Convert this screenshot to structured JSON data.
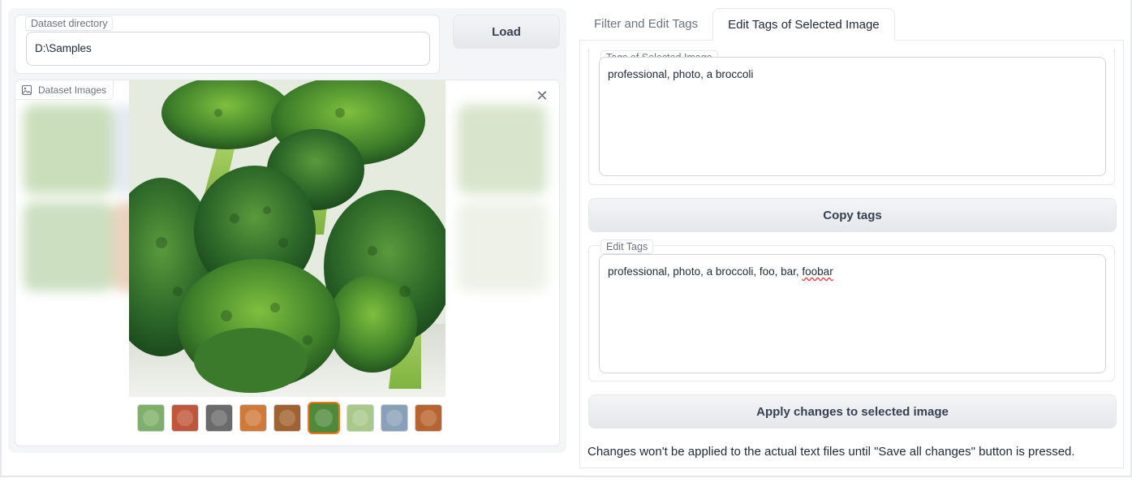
{
  "left": {
    "dataset_directory": {
      "label": "Dataset directory",
      "value": "D:\\Samples"
    },
    "load_button": "Load",
    "gallery": {
      "label": "Dataset Images",
      "selected_index": 5,
      "thumbnails": [
        {
          "name": "broccoli-tree",
          "bg": "#7fb069"
        },
        {
          "name": "pizza",
          "bg": "#c0563a"
        },
        {
          "name": "einstein-bw",
          "bg": "#6b6b6b"
        },
        {
          "name": "pizza",
          "bg": "#d07a3a"
        },
        {
          "name": "einstein-color",
          "bg": "#a0622e"
        },
        {
          "name": "broccoli",
          "bg": "#4f8a3a"
        },
        {
          "name": "broccoli",
          "bg": "#a9c98a"
        },
        {
          "name": "einstein-color",
          "bg": "#8aa0b8"
        },
        {
          "name": "pizza",
          "bg": "#b8642e"
        }
      ]
    }
  },
  "right": {
    "tabs": [
      {
        "label": "Filter and Edit Tags",
        "active": false
      },
      {
        "label": "Edit Tags of Selected Image",
        "active": true
      }
    ],
    "tags_of_selected_image": {
      "label": "Tags of Selected Image",
      "value": "professional, photo, a broccoli"
    },
    "copy_tags_button": "Copy tags",
    "edit_tags": {
      "label": "Edit Tags",
      "value_prefix": "professional, photo, a broccoli, foo, bar, ",
      "value_misspelled": "foobar"
    },
    "apply_button": "Apply changes to selected image",
    "note": "Changes won't be applied to the actual text files until \"Save all changes\" button is pressed."
  },
  "colors": {
    "accent_selected": "#f97316",
    "spellcheck": "#ef4444"
  }
}
